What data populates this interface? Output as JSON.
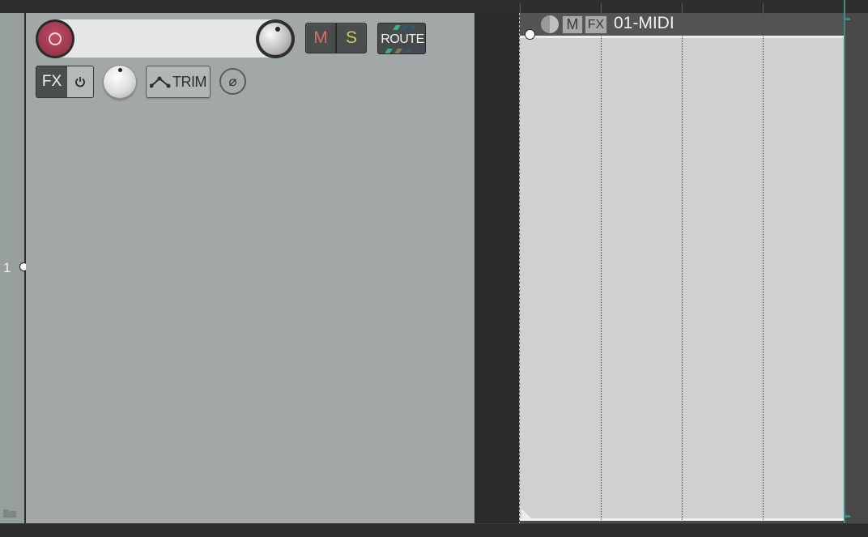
{
  "track": {
    "number": "1",
    "name": "",
    "buttons": {
      "mute": "M",
      "solo": "S",
      "route": "ROUTE",
      "fx": "FX",
      "trim": "TRIM",
      "phase": "⌀"
    }
  },
  "media_item": {
    "name": "01-MIDI",
    "buttons": {
      "mute": "M",
      "fx": "FX"
    }
  },
  "colors": {
    "rec_arm": "#b0425a",
    "edit_cursor": "#3c8c82",
    "mute_text": "#d86c64",
    "solo_text": "#d2c85c",
    "tcp_background": "#a2a8a8",
    "item_background": "#cfd1d0"
  }
}
